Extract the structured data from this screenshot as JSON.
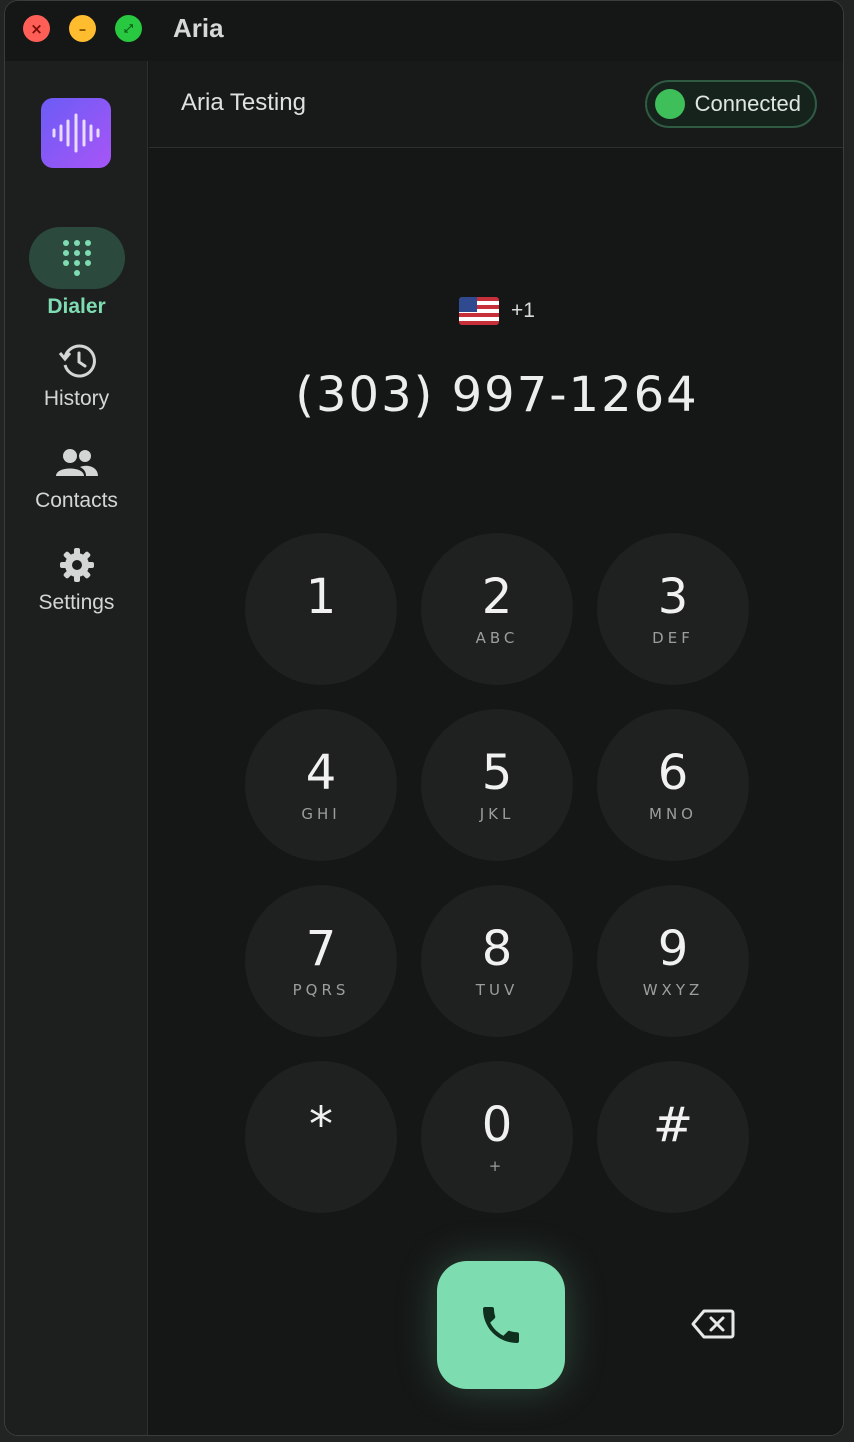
{
  "window": {
    "title": "Aria"
  },
  "sidebar": {
    "items": [
      {
        "label": "Dialer",
        "icon": "dialpad-icon",
        "active": true
      },
      {
        "label": "History",
        "icon": "history-icon",
        "active": false
      },
      {
        "label": "Contacts",
        "icon": "contacts-icon",
        "active": false
      },
      {
        "label": "Settings",
        "icon": "gear-icon",
        "active": false
      }
    ]
  },
  "header": {
    "account_name": "Aria Testing",
    "status": "Connected",
    "status_color": "#3fbf59"
  },
  "dialer": {
    "country_code": "+1",
    "country_flag": "us-flag-icon",
    "phone_number": "(303) 997-1264",
    "keys": [
      {
        "digit": "1",
        "letters": ""
      },
      {
        "digit": "2",
        "letters": "ABC"
      },
      {
        "digit": "3",
        "letters": "DEF"
      },
      {
        "digit": "4",
        "letters": "GHI"
      },
      {
        "digit": "5",
        "letters": "JKL"
      },
      {
        "digit": "6",
        "letters": "MNO"
      },
      {
        "digit": "7",
        "letters": "PQRS"
      },
      {
        "digit": "8",
        "letters": "TUV"
      },
      {
        "digit": "9",
        "letters": "WXYZ"
      },
      {
        "digit": "*",
        "letters": ""
      },
      {
        "digit": "0",
        "letters": "+"
      },
      {
        "digit": "#",
        "letters": ""
      }
    ],
    "call_color": "#7ddcb0"
  },
  "colors": {
    "accent": "#7fdcb2",
    "logo_gradient_start": "#6b5cf5",
    "logo_gradient_end": "#a855f7"
  }
}
